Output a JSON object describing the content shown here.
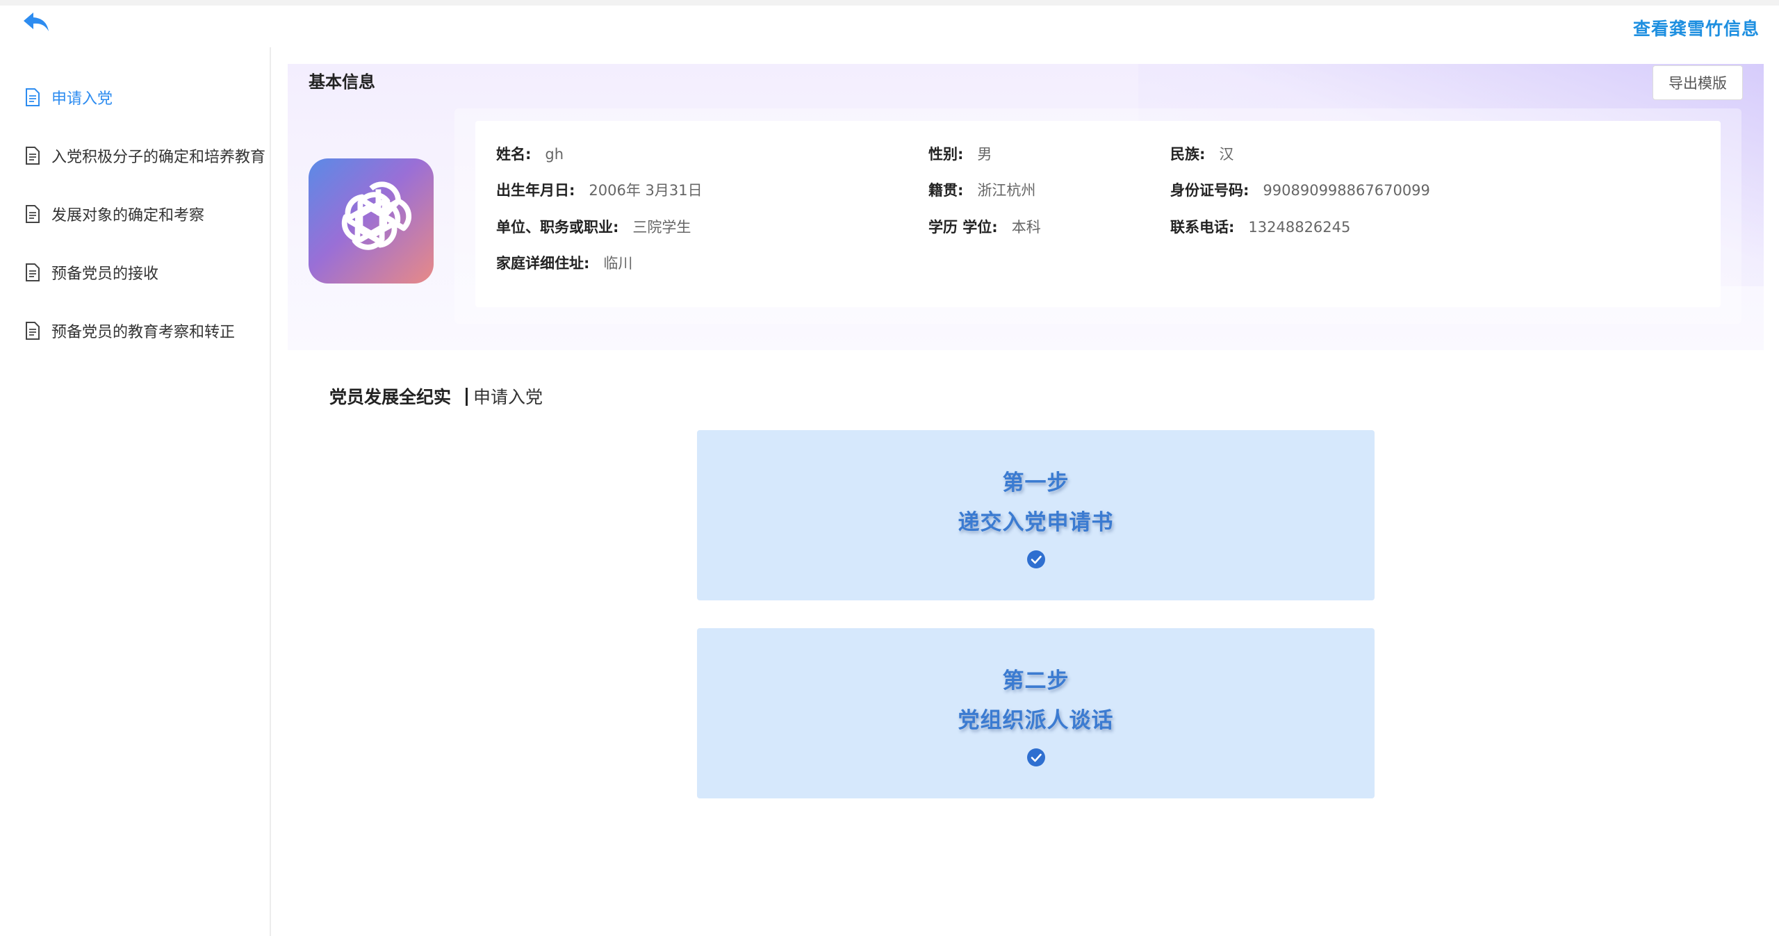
{
  "header": {
    "back_icon": "back-arrow-icon",
    "view_info_link": "查看龚雪竹信息",
    "accent": "#1e8fe0"
  },
  "sidebar": {
    "items": [
      {
        "label": "申请入党",
        "active": true,
        "icon": "document-icon"
      },
      {
        "label": "入党积极分子的确定和培养教育",
        "active": false,
        "icon": "document-icon"
      },
      {
        "label": "发展对象的确定和考察",
        "active": false,
        "icon": "document-icon"
      },
      {
        "label": "预备党员的接收",
        "active": false,
        "icon": "document-icon"
      },
      {
        "label": "预备党员的教育考察和转正",
        "active": false,
        "icon": "document-icon"
      }
    ],
    "active_color": "#2d8cf0"
  },
  "basic_info": {
    "title": "基本信息",
    "export_button": "导出模版",
    "avatar_icon": "openai-logo-icon",
    "fields": {
      "name": {
        "label": "姓名:",
        "value": "gh"
      },
      "gender": {
        "label": "性别:",
        "value": "男"
      },
      "ethnicity": {
        "label": "民族:",
        "value": "汉"
      },
      "birthdate": {
        "label": "出生年月日:",
        "value": "2006年 3月31日"
      },
      "native_place": {
        "label": "籍贯:",
        "value": "浙江杭州"
      },
      "id_number": {
        "label": "身份证号码:",
        "value": "990890998867670099"
      },
      "occupation": {
        "label": "单位、职务或职业:",
        "value": "三院学生"
      },
      "education": {
        "label": "学历 学位:",
        "value": "本科"
      },
      "phone": {
        "label": "联系电话:",
        "value": "13248826245"
      },
      "address": {
        "label": "家庭详细住址:",
        "value": "临川"
      }
    }
  },
  "record": {
    "title": "党员发展全纪实",
    "subtitle": "申请入党",
    "steps": [
      {
        "step": "第一步",
        "name": "递交入党申请书",
        "done": true,
        "icon": "check-circle-icon"
      },
      {
        "step": "第二步",
        "name": "党组织派人谈话",
        "done": true,
        "icon": "check-circle-icon"
      }
    ],
    "step_bg": "#d6e8fc",
    "step_text_color": "#3b7bd1"
  }
}
